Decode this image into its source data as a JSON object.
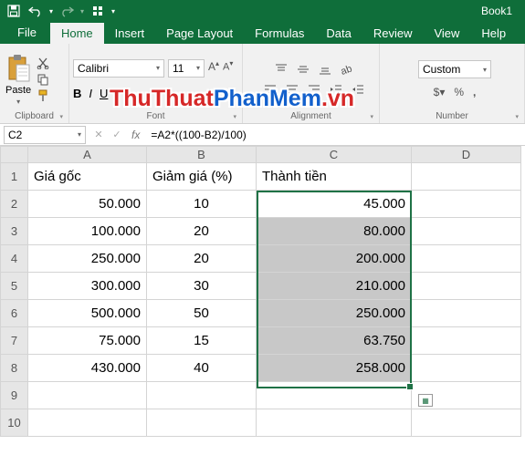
{
  "title": "Book1",
  "qat": {
    "save": "save-icon",
    "undo": "undo-icon",
    "redo": "redo-icon",
    "custom": "custom-icon"
  },
  "tabs": {
    "file": "File",
    "items": [
      "Home",
      "Insert",
      "Page Layout",
      "Formulas",
      "Data",
      "Review",
      "View",
      "Help"
    ],
    "active": "Home"
  },
  "ribbon": {
    "clipboard": {
      "paste": "Paste",
      "group": "Clipboard"
    },
    "font": {
      "name": "Calibri",
      "size": "11",
      "group": "Font",
      "bold": "B",
      "italic": "I",
      "underline": "U"
    },
    "alignment": {
      "group": "Alignment"
    },
    "number": {
      "format": "Custom",
      "group": "Number"
    }
  },
  "namebox": "C2",
  "formula": "=A2*((100-B2)/100)",
  "fx": "fx",
  "columns": [
    "A",
    "B",
    "C",
    "D"
  ],
  "rows": [
    "1",
    "2",
    "3",
    "4",
    "5",
    "6",
    "7",
    "8",
    "9",
    "10"
  ],
  "headers": {
    "a": "Giá gốc",
    "b": "Giảm giá (%)",
    "c": "Thành tiền"
  },
  "data": [
    {
      "a": "50.000",
      "b": "10",
      "c": "45.000"
    },
    {
      "a": "100.000",
      "b": "20",
      "c": "80.000"
    },
    {
      "a": "250.000",
      "b": "20",
      "c": "200.000"
    },
    {
      "a": "300.000",
      "b": "30",
      "c": "210.000"
    },
    {
      "a": "500.000",
      "b": "50",
      "c": "250.000"
    },
    {
      "a": "75.000",
      "b": "15",
      "c": "63.750"
    },
    {
      "a": "430.000",
      "b": "40",
      "c": "258.000"
    }
  ],
  "watermark": {
    "part1": "ThuThuat",
    "part2": "PhanMem",
    "part3": ".vn"
  }
}
